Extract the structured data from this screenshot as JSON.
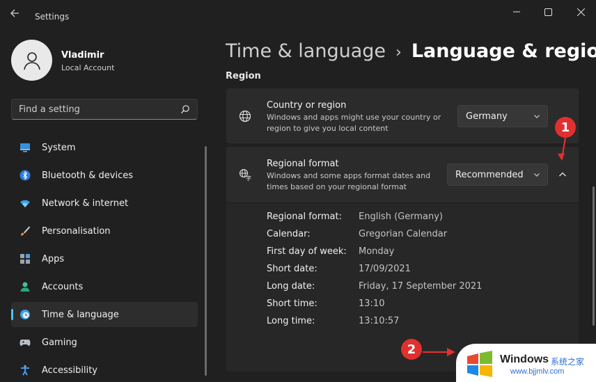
{
  "window": {
    "title": "Settings"
  },
  "user": {
    "name": "Vladimir",
    "account_type": "Local Account"
  },
  "search": {
    "placeholder": "Find a setting"
  },
  "sidebar": {
    "items": [
      {
        "label": "System",
        "icon": "monitor-icon"
      },
      {
        "label": "Bluetooth & devices",
        "icon": "bluetooth-icon"
      },
      {
        "label": "Network & internet",
        "icon": "wifi-icon"
      },
      {
        "label": "Personalisation",
        "icon": "brush-icon"
      },
      {
        "label": "Apps",
        "icon": "apps-icon"
      },
      {
        "label": "Accounts",
        "icon": "person-icon"
      },
      {
        "label": "Time & language",
        "icon": "clock-globe-icon",
        "active": true
      },
      {
        "label": "Gaming",
        "icon": "gamepad-icon"
      },
      {
        "label": "Accessibility",
        "icon": "accessibility-icon"
      }
    ]
  },
  "breadcrumb": {
    "parent": "Time & language",
    "separator": "›",
    "current": "Language & region"
  },
  "region": {
    "section_label": "Region",
    "country": {
      "title": "Country or region",
      "description": "Windows and apps might use your country or region to give you local content",
      "value": "Germany"
    },
    "format": {
      "title": "Regional format",
      "description": "Windows and some apps format dates and times based on your regional format",
      "value": "Recommended"
    },
    "details": [
      {
        "label": "Regional format:",
        "value": "English (Germany)"
      },
      {
        "label": "Calendar:",
        "value": "Gregorian Calendar"
      },
      {
        "label": "First day of week:",
        "value": "Monday"
      },
      {
        "label": "Short date:",
        "value": "17/09/2021"
      },
      {
        "label": "Long date:",
        "value": "Friday, 17 September 2021"
      },
      {
        "label": "Short time:",
        "value": "13:10"
      },
      {
        "label": "Long time:",
        "value": "13:10:57"
      }
    ]
  },
  "annotations": {
    "badge1": "1",
    "badge2": "2"
  },
  "watermark": {
    "brand": "Windows",
    "cn_text": "系统之家",
    "url": "www.bjjmlv.com"
  },
  "colors": {
    "accent": "#4cc2ff",
    "annotation_red": "#e03030"
  }
}
